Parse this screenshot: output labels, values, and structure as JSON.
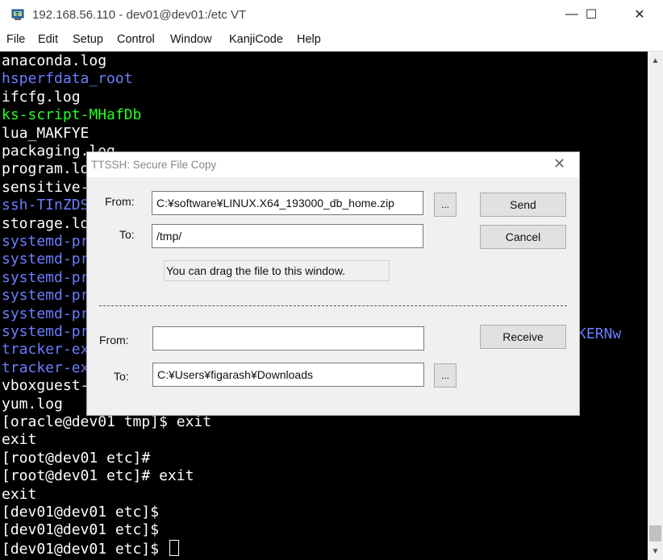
{
  "window": {
    "title": "192.168.56.110 - dev01@dev01:/etc VT",
    "minimize_glyph": "—",
    "maximize_glyph": "☐",
    "close_glyph": "✕"
  },
  "menu": [
    "File",
    "Edit",
    "Setup",
    "Control",
    "Window",
    "KanjiCode",
    "Help"
  ],
  "terminal": {
    "lines": [
      {
        "text": "anaconda.log",
        "color": "white"
      },
      {
        "text": "hsperfdata_root",
        "color": "blue"
      },
      {
        "text": "ifcfg.log",
        "color": "white"
      },
      {
        "text": "ks-script-MHafDb",
        "color": "green"
      },
      {
        "text": "lua_MAKFYE",
        "color": "white"
      },
      {
        "text": "packaging.log",
        "color": "white"
      },
      {
        "text": "program.log",
        "color": "white"
      },
      {
        "text": "sensitive-",
        "color": "white"
      },
      {
        "text": "ssh-TInZDS",
        "color": "blue"
      },
      {
        "text": "storage.log",
        "color": "white"
      },
      {
        "text": "systemd-pr",
        "color": "blue"
      },
      {
        "text": "systemd-pr",
        "color": "blue"
      },
      {
        "text": "systemd-pr",
        "color": "blue"
      },
      {
        "text": "systemd-pr",
        "color": "blue"
      },
      {
        "text": "systemd-pr",
        "color": "blue"
      },
      {
        "text": "systemd-pr",
        "color": "blue"
      },
      {
        "text": "tracker-ext",
        "color": "blue"
      },
      {
        "text": "tracker-ext",
        "color": "blue"
      },
      {
        "text": "vboxguest-M",
        "color": "white"
      },
      {
        "text": "yum.log",
        "color": "white"
      },
      {
        "text": "[oracle@dev01 tmp]$ exit",
        "color": "white"
      },
      {
        "text": "exit",
        "color": "white"
      },
      {
        "text": "[root@dev01 etc]#",
        "color": "white"
      },
      {
        "text": "[root@dev01 etc]# exit",
        "color": "white"
      },
      {
        "text": "exit",
        "color": "white"
      },
      {
        "text": "[dev01@dev01 etc]$",
        "color": "white"
      },
      {
        "text": "[dev01@dev01 etc]$",
        "color": "white"
      },
      {
        "text": "[dev01@dev01 etc]$ ",
        "color": "white"
      }
    ],
    "right_fragment": "KERNw",
    "colors": {
      "white": "#ffffff",
      "blue": "#6b7dff",
      "green": "#22ff22",
      "background": "#000000"
    }
  },
  "dialog": {
    "title": "TTSSH: Secure File Copy",
    "send": {
      "from_label": "From:",
      "from_value": "C:¥software¥LINUX.X64_193000_db_home.zip",
      "to_label": "To:",
      "to_value": "/tmp/",
      "browse_label": "...",
      "send_button": "Send",
      "cancel_button": "Cancel",
      "hint": "You can drag the file to this window."
    },
    "receive": {
      "from_label": "From:",
      "from_value": "",
      "to_label": "To:",
      "to_value": "C:¥Users¥figarash¥Downloads",
      "browse_label": "...",
      "receive_button": "Receive"
    }
  }
}
